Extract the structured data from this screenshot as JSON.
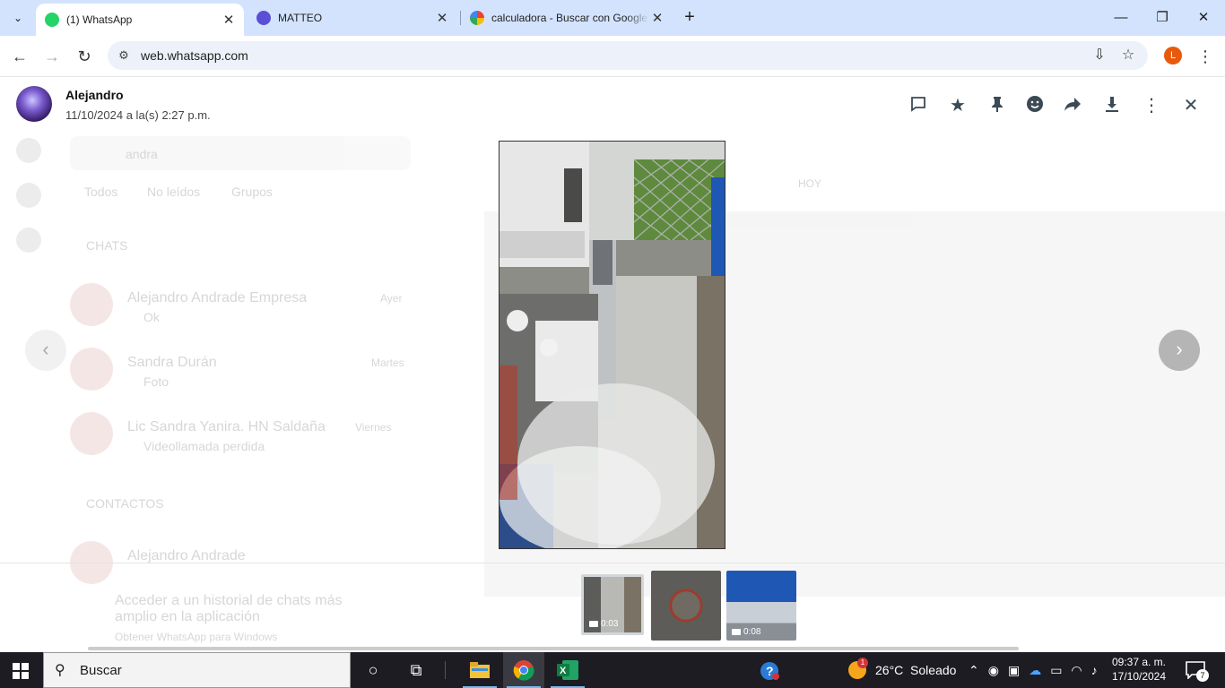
{
  "browser": {
    "tabs": [
      {
        "title": "(1) WhatsApp",
        "active": true,
        "favicon_color": "#25d366"
      },
      {
        "title": "MATTEO",
        "active": false,
        "favicon_color": "#5b4fd6"
      },
      {
        "title": "calculadora - Buscar con Google",
        "active": false,
        "favicon_color": "#4285f4"
      }
    ],
    "url": "web.whatsapp.com",
    "profile_initial": "L"
  },
  "viewer": {
    "sender": "Alejandro",
    "timestamp": "11/10/2024 a la(s) 2:27 p.m.",
    "actions": [
      "reply-icon",
      "star-icon",
      "pin-icon",
      "react-icon",
      "forward-icon",
      "download-icon",
      "more-icon",
      "close-icon"
    ],
    "thumbnails": [
      {
        "duration": "0:03",
        "selected": true
      },
      {
        "duration": "",
        "selected": false
      },
      {
        "duration": "0:08",
        "selected": false
      }
    ]
  },
  "background": {
    "search_text": "andra",
    "filters": [
      "Todos",
      "No leídos",
      "Grupos"
    ],
    "chats_header": "CHATS",
    "chats": [
      {
        "name": "Alejandro Andrade Empresa",
        "preview": "Ok",
        "time": "Ayer"
      },
      {
        "name": "Sandra Durán",
        "preview": "Foto",
        "time": "Martes"
      },
      {
        "name": "Lic Sandra Yanira. HN Saldaña",
        "preview": "Videollamada perdida",
        "time": "Viernes"
      }
    ],
    "contacts_header": "CONTACTOS",
    "contacts": [
      {
        "name": "Alejandro Andrade"
      }
    ],
    "promo_title": "Acceder a un historial de chats más amplio en la aplicación",
    "promo_sub": "Obtener WhatsApp para Windows",
    "date_chip": "HOY"
  },
  "taskbar": {
    "search_placeholder": "Buscar",
    "weather": "26°C  Soleado",
    "weather_badge": "1",
    "time": "09:37 a. m.",
    "date": "17/10/2024",
    "notifications": "7"
  }
}
